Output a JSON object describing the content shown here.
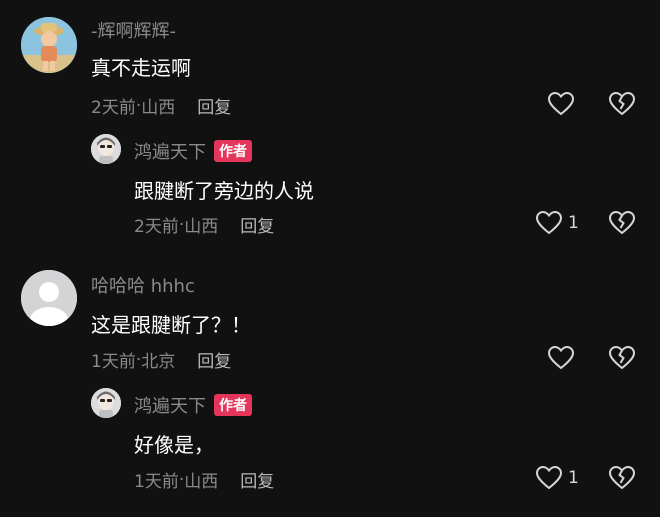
{
  "colors": {
    "background": "#111112",
    "author_tag": "#e6355a",
    "muted": "#8a8a8e",
    "icon": "#d6d6d8"
  },
  "comments": [
    {
      "username": "-辉啊辉辉-",
      "text": "真不走运啊",
      "time": "2天前",
      "location": "山西",
      "reply_label": "回复",
      "like_count": "",
      "avatar": "cartoon-avatar",
      "reply": {
        "username": "鸿遍天下",
        "tag": "作者",
        "text": "跟腱断了旁边的人说",
        "time": "2天前",
        "location": "山西",
        "reply_label": "回复",
        "like_count": "1"
      }
    },
    {
      "username": "哈哈哈 hhhc",
      "text": "这是跟腱断了？！",
      "time": "1天前",
      "location": "北京",
      "reply_label": "回复",
      "like_count": "",
      "avatar": "default-avatar",
      "reply": {
        "username": "鸿遍天下",
        "tag": "作者",
        "text": "好像是，",
        "time": "1天前",
        "location": "山西",
        "reply_label": "回复",
        "like_count": "1"
      }
    }
  ],
  "meta_separator": " · "
}
